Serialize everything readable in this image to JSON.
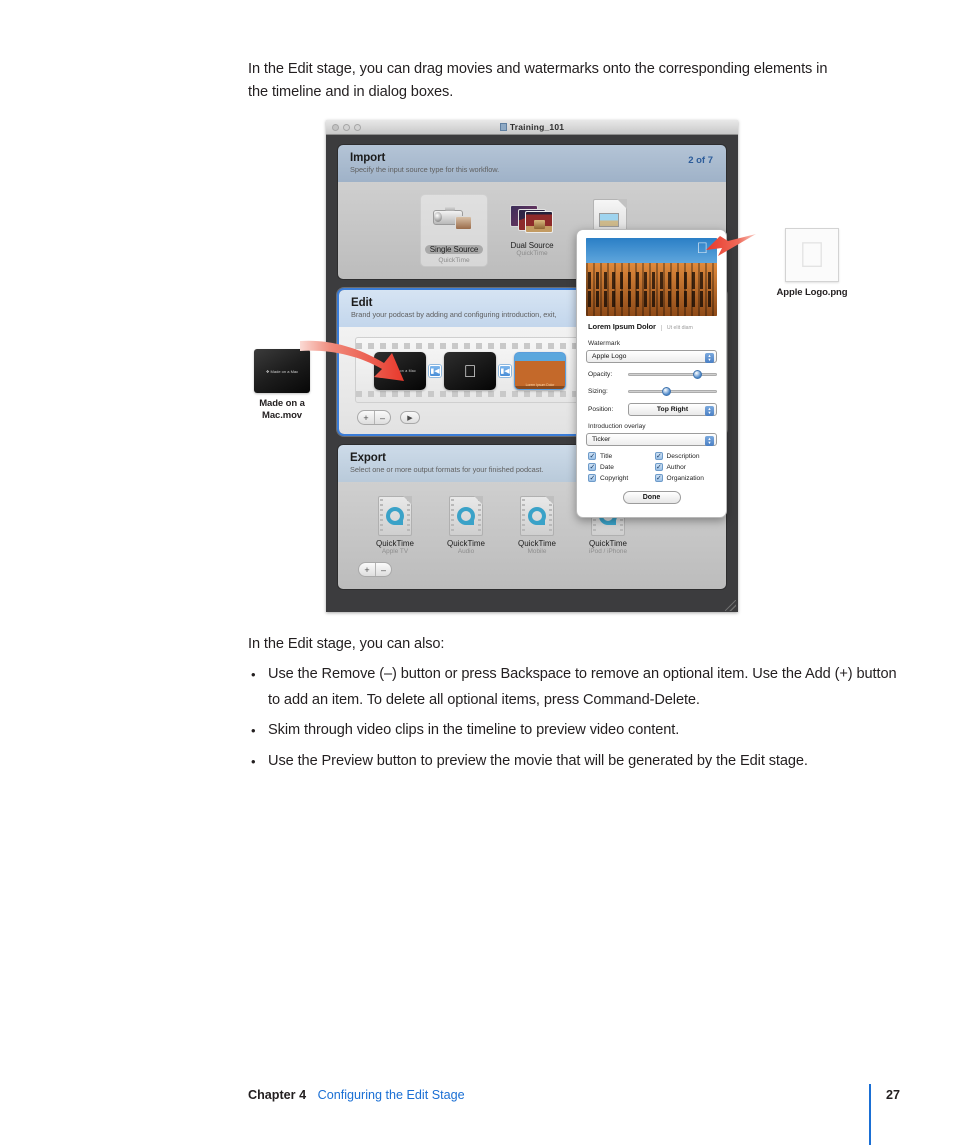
{
  "document": {
    "intro_paragraph": "In the Edit stage, you can drag movies and watermarks onto the corresponding elements in the timeline and in dialog boxes.",
    "also_lead": "In the Edit stage, you can also:",
    "bullets": [
      "Use the Remove (–) button or press Backspace to remove an optional item. Use the Add (+) button to add an item. To delete all optional items, press Command-Delete.",
      "Skim through video clips in the timeline to preview video content.",
      "Use the Preview button to preview the movie that will be generated by the Edit stage."
    ]
  },
  "footer": {
    "chapter": "Chapter 4",
    "chapter_title": "Configuring the Edit Stage",
    "page_number": "27",
    "rule_color": "#1a6fd4"
  },
  "screenshot": {
    "window": {
      "title": "Training_101",
      "title_icon": "document-icon",
      "traffic_lights": [
        "close-button",
        "minimize-button",
        "zoom-button"
      ],
      "background_color": "#3c3c3e"
    },
    "stages": [
      {
        "id": "import",
        "title": "Import",
        "subtitle": "Specify the input source type for this workflow.",
        "counter": "2 of 7",
        "counter_color": "#2c5c9a",
        "sources": [
          {
            "name": "Single Source",
            "sub": "QuickTime",
            "icon": "camcorder-icon",
            "selected": true
          },
          {
            "name": "Dual Source",
            "sub": "QuickTime",
            "icon": "dual-screen-icon",
            "selected": false
          },
          {
            "name": "",
            "sub": "",
            "icon": "image-file-icon",
            "selected": false
          }
        ]
      },
      {
        "id": "edit",
        "title": "Edit",
        "subtitle": "Brand your podcast by adding and configuring introduction, exit,",
        "selected": true,
        "selection_color": "#3b7dd8",
        "timeline": {
          "clips": [
            {
              "type": "movie",
              "label": "❖ Made on a Mac",
              "icon": "movie-clip"
            },
            {
              "type": "movie",
              "label": "",
              "icon": "apple-logo-clip"
            },
            {
              "type": "photo",
              "label": "Lorem Ipsum Dolor",
              "icon": "photo-clip",
              "selected": true
            }
          ],
          "transitions": [
            "transition-icon",
            "transition-icon"
          ],
          "controls": {
            "add_label": "+",
            "remove_label": "–",
            "preview_label": "▶"
          }
        }
      },
      {
        "id": "export",
        "title": "Export",
        "subtitle": "Select one or more output formats for your finished podcast.",
        "formats": [
          {
            "name": "QuickTime",
            "sub": "Apple TV",
            "icon": "quicktime-icon"
          },
          {
            "name": "QuickTime",
            "sub": "Audio",
            "icon": "quicktime-icon"
          },
          {
            "name": "QuickTime",
            "sub": "Mobile",
            "icon": "quicktime-icon"
          },
          {
            "name": "QuickTime",
            "sub": "iPod / iPhone",
            "icon": "quicktime-icon"
          }
        ],
        "controls": {
          "add_label": "+",
          "remove_label": "–"
        }
      }
    ],
    "dialog": {
      "preview_image_alt": "colosseum-photo",
      "watermark_overlay_icon": "apple-logo-watermark",
      "caption_title": "Lorem Ipsum Dolor",
      "caption_desc": "Ut elit diam",
      "watermark_label": "Watermark",
      "watermark_value": "Apple Logo",
      "opacity_label": "Opacity:",
      "opacity_value": 78,
      "sizing_label": "Sizing:",
      "sizing_value": 42,
      "position_label": "Position:",
      "position_value": "Top Right",
      "intro_overlay_label": "Introduction overlay",
      "intro_overlay_value": "Ticker",
      "checkboxes": [
        {
          "label": "Title",
          "checked": true
        },
        {
          "label": "Description",
          "checked": true
        },
        {
          "label": "Date",
          "checked": true
        },
        {
          "label": "Author",
          "checked": true
        },
        {
          "label": "Copyright",
          "checked": true
        },
        {
          "label": "Organization",
          "checked": true
        }
      ],
      "done_label": "Done"
    }
  },
  "callouts": {
    "apple_logo": {
      "label": "Apple Logo.png",
      "icon": "apple-logo-file-icon"
    },
    "made_on_a_mac": {
      "label": "Made on a Mac.mov",
      "icon": "movie-file-icon",
      "thumb_text": "❖ Made on a Mac"
    },
    "arrow_color": "#e8392c"
  }
}
